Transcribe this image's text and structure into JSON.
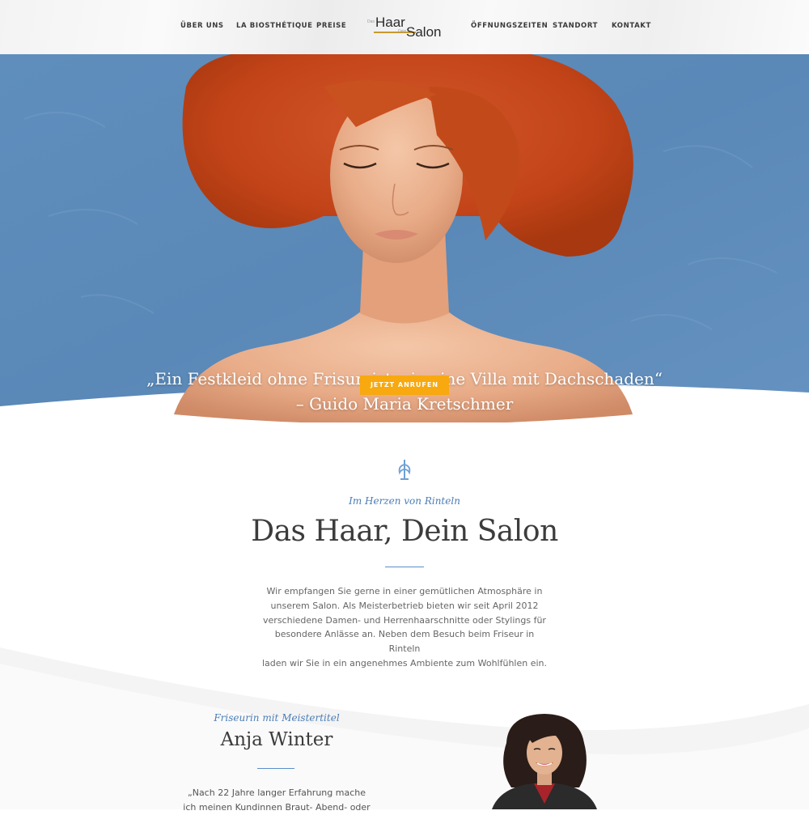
{
  "nav": {
    "left": [
      "ÜBER UNS",
      "LA BIOSTHÉTIQUE",
      "PREISE"
    ],
    "right": [
      "ÖFFNUNGSZEITEN",
      "STANDORT",
      "KONTAKT"
    ]
  },
  "logo": {
    "das": "Das",
    "haar": "Haar",
    "dein": "Dein",
    "salon": "Salon"
  },
  "hero": {
    "quote_line1": "„Ein Festkleid ohne Frisur, ist wie eine Villa mit Dachschaden“",
    "quote_line2": "– Guido Maria Kretschmer",
    "cta_label": "JETZT ANRUFEN"
  },
  "intro": {
    "kicker": "Im Herzen von Rinteln",
    "title": "Das Haar, Dein Salon",
    "paragraph_lines": [
      "Wir empfangen Sie gerne in einer gemütlichen Atmosphäre in",
      "unserem Salon. Als  Meisterbetrieb bieten wir seit April 2012",
      "verschiedene  Damen- und  Herrenhaarschnitte oder Stylings für",
      "besondere Anlässe an.  Neben dem  Besuch beim  Friseur in  Rinteln",
      "laden wir Sie in ein angenehmes Ambiente zum Wohlfühlen ein."
    ]
  },
  "profile": {
    "kicker": "Friseurin mit Meistertitel",
    "name": "Anja Winter",
    "text_lines": [
      "„Nach 22 Jahre langer  Erfahrung mache",
      "ich meinen  Kundinnen  Braut-  Abend- oder"
    ]
  },
  "colors": {
    "accent_blue": "#4a7db5",
    "hero_blue": "#5b89b8",
    "cta_orange": "#f7a90f",
    "hair": "#c4481c"
  }
}
